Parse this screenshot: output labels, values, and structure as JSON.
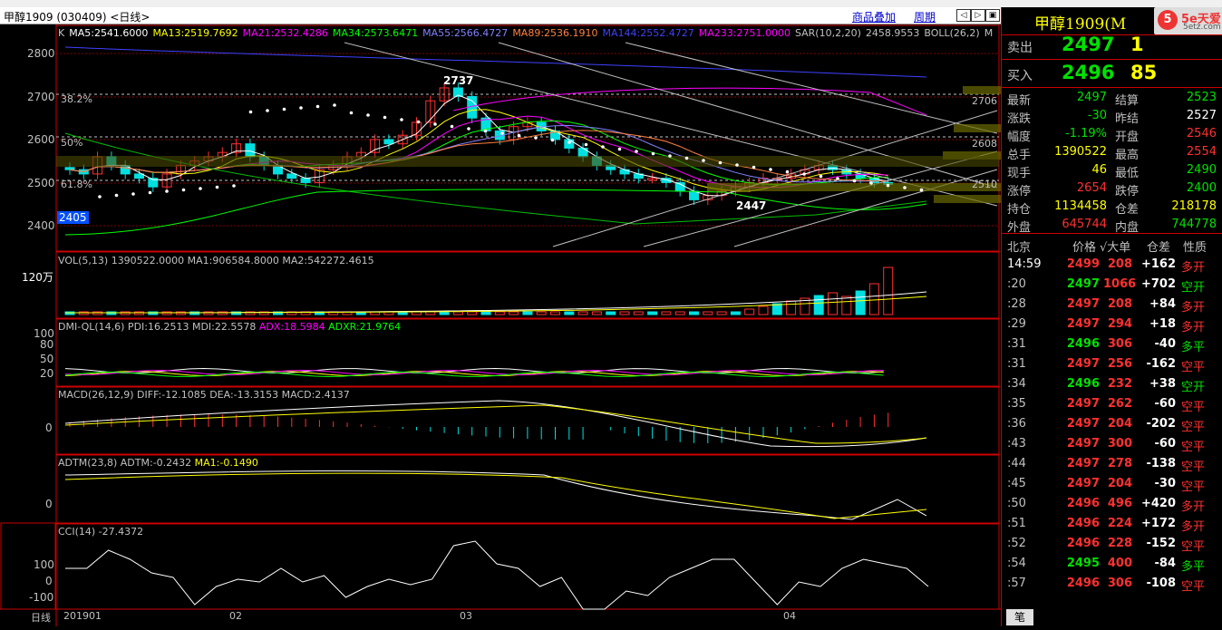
{
  "window": {
    "title": "甲醇1909 (030409) <日线>",
    "overlay_link": "商品叠加",
    "cycle_link": "周期"
  },
  "panes": {
    "kline": {
      "legend": [
        {
          "text": "K",
          "color": "#c0c0c0"
        },
        {
          "text": "MA5:2541.6000",
          "color": "#ffffff"
        },
        {
          "text": "MA13:2519.7692",
          "color": "#ffff00"
        },
        {
          "text": "MA21:2532.4286",
          "color": "#ff00ff"
        },
        {
          "text": "MA34:2573.6471",
          "color": "#00ff00"
        },
        {
          "text": "MA55:2566.4727",
          "color": "#8080ff"
        },
        {
          "text": "MA89:2536.1910",
          "color": "#ff8040"
        },
        {
          "text": "MA144:2552.4727",
          "color": "#4040ff"
        },
        {
          "text": "MA233:2751.0000",
          "color": "#ff00ff"
        },
        {
          "text": "SAR(10,2,20)",
          "color": "#c0c0c0"
        },
        {
          "text": "2458.9553",
          "color": "#c0c0c0"
        },
        {
          "text": "BOLL(26,2)",
          "color": "#c0c0c0"
        },
        {
          "text": "M",
          "color": "#c0c0c0"
        }
      ],
      "y_ticks": [
        "2800",
        "2700",
        "2600",
        "2500",
        "2400"
      ],
      "fib_labels": [
        "38.2%",
        "50%",
        "61.8%"
      ],
      "price_labels": {
        "high": "2737",
        "low": "2447",
        "current": "2405"
      },
      "right_levels": [
        "2706",
        "2608",
        "2510"
      ]
    },
    "vol": {
      "legend": "VOL(5,13) 1390522.0000 MA1:906584.8000 MA2:542272.4615",
      "y_tick": "120万"
    },
    "dmi": {
      "legend_main": "DMI-QL(14,6) PDI:16.2513 MDI:22.5578",
      "legend_adx": "ADX:18.5984",
      "legend_adxr": "ADXR:21.9764",
      "y_ticks": [
        "100",
        "80",
        "50",
        "20"
      ]
    },
    "macd": {
      "legend": "MACD(26,12,9) DIFF:-12.1085 DEA:-13.3153 MACD:2.4137",
      "y_tick": "0"
    },
    "adtm": {
      "legend_main": "ADTM(23,8) ADTM:-0.2432",
      "legend_ma": "MA1:-0.1490",
      "y_tick": "0"
    },
    "cci": {
      "legend": "CCI(14) -27.4372",
      "y_ticks": [
        "100",
        "0",
        "-100"
      ]
    }
  },
  "x_axis": {
    "cycle": "日线",
    "labels": [
      "201901",
      "02",
      "03",
      "04"
    ]
  },
  "quote": {
    "name": "甲醇1909(M",
    "logo_text": "5e天爱",
    "logo_sub": "5etz.com",
    "sell": {
      "label": "卖出",
      "price": "2497",
      "volume": "1"
    },
    "buy": {
      "label": "买入",
      "price": "2496",
      "volume": "85"
    },
    "stats": [
      {
        "l1": "最新",
        "v1": "2497",
        "c1": "#00e000",
        "l2": "结算",
        "v2": "2523",
        "c2": "#00e000"
      },
      {
        "l1": "涨跌",
        "v1": "-30",
        "c1": "#00e000",
        "l2": "昨结",
        "v2": "2527",
        "c2": "#ffffff"
      },
      {
        "l1": "幅度",
        "v1": "-1.19%",
        "c1": "#00e000",
        "l2": "开盘",
        "v2": "2546",
        "c2": "#ff3030"
      },
      {
        "l1": "总手",
        "v1": "1390522",
        "c1": "#ffff00",
        "l2": "最高",
        "v2": "2554",
        "c2": "#ff3030"
      },
      {
        "l1": "现手",
        "v1": "46",
        "c1": "#ffff00",
        "l2": "最低",
        "v2": "2490",
        "c2": "#00e000"
      },
      {
        "l1": "涨停",
        "v1": "2654",
        "c1": "#ff3030",
        "l2": "跌停",
        "v2": "2400",
        "c2": "#00e000"
      },
      {
        "l1": "持仓",
        "v1": "1134458",
        "c1": "#ffff00",
        "l2": "仓差",
        "v2": "218178",
        "c2": "#ffff00"
      },
      {
        "l1": "外盘",
        "v1": "645744",
        "c1": "#ff3030",
        "l2": "内盘",
        "v2": "744778",
        "c2": "#00e000"
      }
    ],
    "tick_header": {
      "loc": "北京",
      "price": "价格",
      "vol": "√大单",
      "oi": "仓差",
      "type": "性质"
    },
    "ticks": [
      {
        "t": "14:59",
        "p": "2499",
        "v": "208",
        "d": "+162",
        "n": "多开",
        "pc": "#ff3030",
        "nc": "#ff3030"
      },
      {
        "t": ":20",
        "p": "2497",
        "v": "1066",
        "d": "+702",
        "n": "空开",
        "pc": "#00e000",
        "nc": "#00e000"
      },
      {
        "t": ":28",
        "p": "2497",
        "v": "208",
        "d": "+84",
        "n": "多开",
        "pc": "#ff3030",
        "nc": "#ff3030"
      },
      {
        "t": ":29",
        "p": "2497",
        "v": "294",
        "d": "+18",
        "n": "多开",
        "pc": "#ff3030",
        "nc": "#ff3030"
      },
      {
        "t": ":31",
        "p": "2496",
        "v": "306",
        "d": "-40",
        "n": "多平",
        "pc": "#00e000",
        "nc": "#00e000"
      },
      {
        "t": ":31",
        "p": "2497",
        "v": "256",
        "d": "-162",
        "n": "空平",
        "pc": "#ff3030",
        "nc": "#ff3030"
      },
      {
        "t": ":34",
        "p": "2496",
        "v": "232",
        "d": "+38",
        "n": "空开",
        "pc": "#00e000",
        "nc": "#00e000"
      },
      {
        "t": ":35",
        "p": "2497",
        "v": "262",
        "d": "-60",
        "n": "空平",
        "pc": "#ff3030",
        "nc": "#ff3030"
      },
      {
        "t": ":36",
        "p": "2497",
        "v": "204",
        "d": "-202",
        "n": "空平",
        "pc": "#ff3030",
        "nc": "#ff3030"
      },
      {
        "t": ":43",
        "p": "2497",
        "v": "300",
        "d": "-60",
        "n": "空平",
        "pc": "#ff3030",
        "nc": "#ff3030"
      },
      {
        "t": ":44",
        "p": "2497",
        "v": "278",
        "d": "-138",
        "n": "空平",
        "pc": "#ff3030",
        "nc": "#ff3030"
      },
      {
        "t": ":45",
        "p": "2497",
        "v": "204",
        "d": "-30",
        "n": "空平",
        "pc": "#ff3030",
        "nc": "#ff3030"
      },
      {
        "t": ":50",
        "p": "2496",
        "v": "496",
        "d": "+420",
        "n": "多开",
        "pc": "#ff3030",
        "nc": "#ff3030"
      },
      {
        "t": ":51",
        "p": "2496",
        "v": "224",
        "d": "+172",
        "n": "多开",
        "pc": "#ff3030",
        "nc": "#ff3030"
      },
      {
        "t": ":52",
        "p": "2496",
        "v": "228",
        "d": "-152",
        "n": "空平",
        "pc": "#ff3030",
        "nc": "#ff3030"
      },
      {
        "t": ":54",
        "p": "2495",
        "v": "400",
        "d": "-84",
        "n": "多平",
        "pc": "#00e000",
        "nc": "#00e000"
      },
      {
        "t": ":57",
        "p": "2496",
        "v": "306",
        "d": "-108",
        "n": "空平",
        "pc": "#ff3030",
        "nc": "#ff3030"
      }
    ],
    "bottom_tab": "笔"
  },
  "colors": {
    "up": "#ff3030",
    "down": "#00e0e0",
    "grid": "#800000",
    "panel_border": "#c00000"
  }
}
